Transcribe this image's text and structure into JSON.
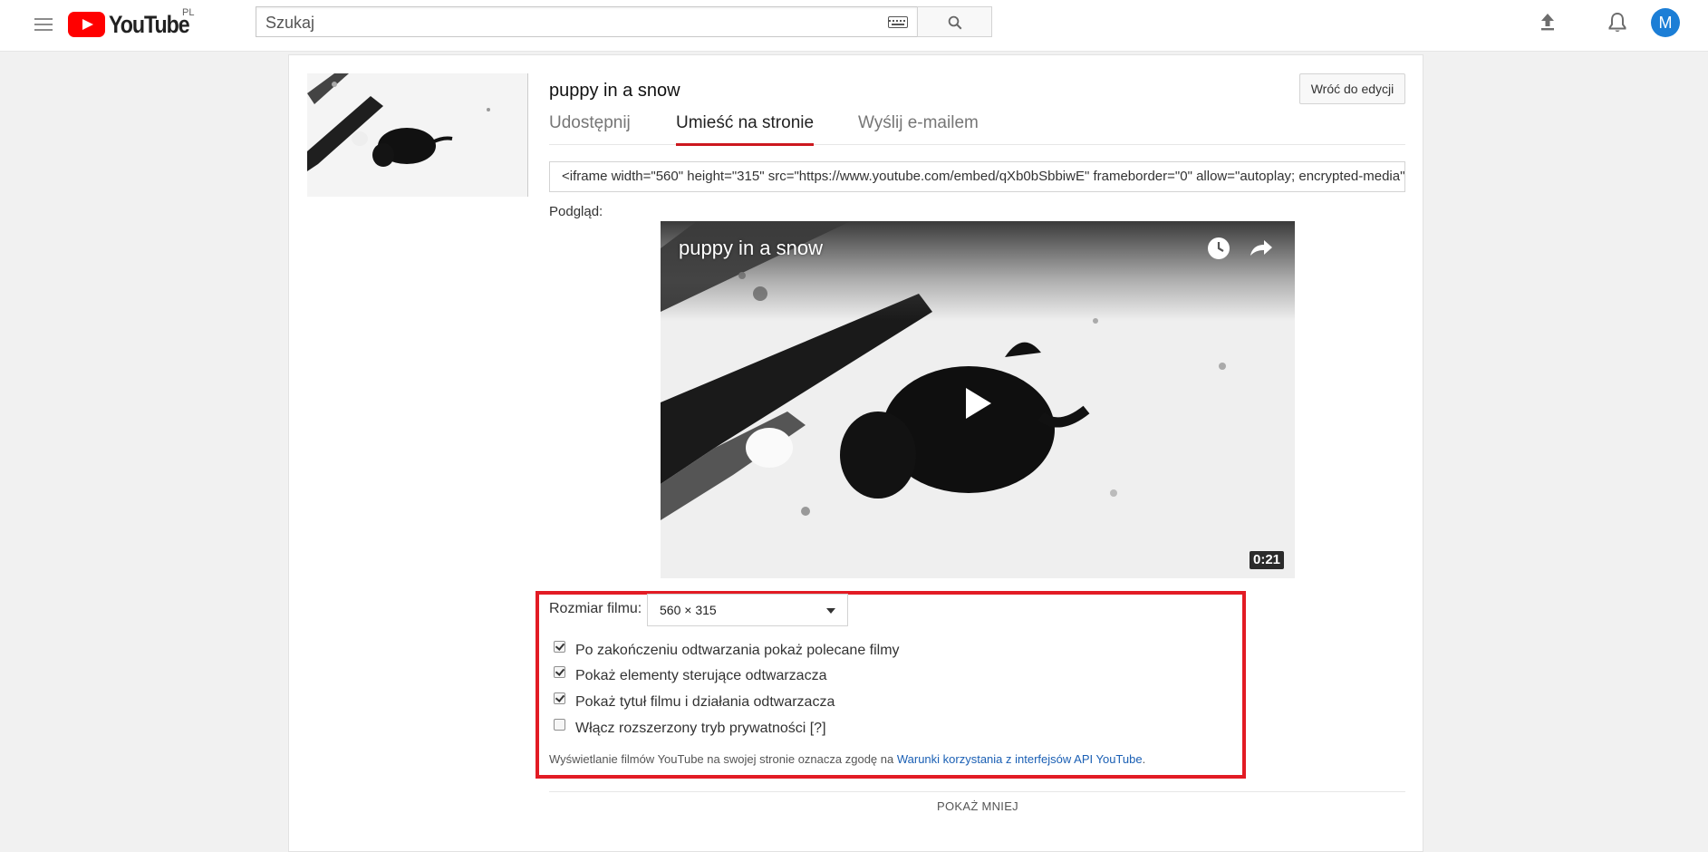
{
  "header": {
    "logo_text": "YouTube",
    "country_code": "PL",
    "search_placeholder": "Szukaj",
    "avatar_letter": "M",
    "icons": [
      "menu-icon",
      "keyboard-icon",
      "search-icon",
      "upload-icon",
      "bell-icon"
    ]
  },
  "video": {
    "title": "puppy in a snow",
    "back_button": "Wróć do edycji",
    "duration": "0:21"
  },
  "tabs": [
    {
      "label": "Udostępnij",
      "active": false
    },
    {
      "label": "Umieść na stronie",
      "active": true
    },
    {
      "label": "Wyślij e-mailem",
      "active": false
    }
  ],
  "embed": {
    "code": "<iframe width=\"560\" height=\"315\" src=\"https://www.youtube.com/embed/qXb0bSbbiwE\" frameborder=\"0\" allow=\"autoplay; encrypted-media\" allowfullscreen></iframe>",
    "preview_label": "Podgląd:"
  },
  "options": {
    "size_label": "Rozmiar filmu:",
    "size_value": "560 × 315",
    "checkboxes": [
      {
        "label": "Po zakończeniu odtwarzania pokaż polecane filmy",
        "checked": true
      },
      {
        "label": "Pokaż elementy sterujące odtwarzacza",
        "checked": true
      },
      {
        "label": "Pokaż tytuł filmu i działania odtwarzacza",
        "checked": true
      },
      {
        "label": "Włącz rozszerzony tryb prywatności [?]",
        "checked": false
      }
    ],
    "terms_text": "Wyświetlanie filmów YouTube na swojej stronie oznacza zgodę na ",
    "terms_link": "Warunki korzystania z interfejsów API YouTube",
    "terms_end": "."
  },
  "footer": {
    "show_less": "POKAŻ MNIEJ"
  },
  "colors": {
    "brand_red": "#ff0000",
    "highlight_box": "#e21b24",
    "tab_underline": "#cc181e",
    "link": "#1a5fb4",
    "avatar": "#1c7ed6"
  }
}
